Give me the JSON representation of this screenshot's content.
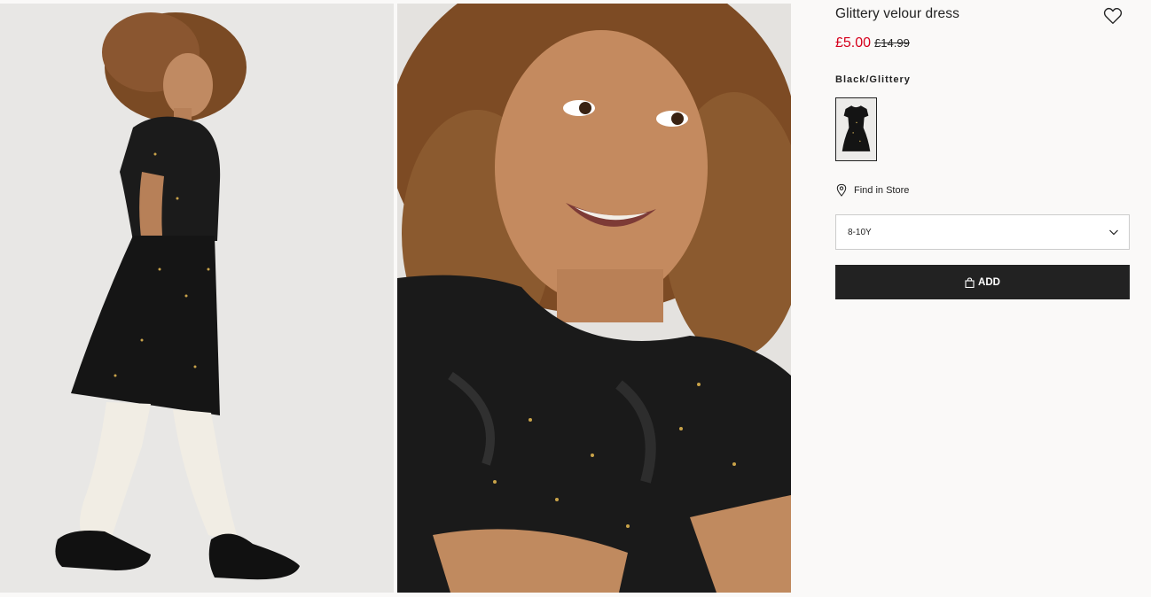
{
  "product": {
    "title": "Glittery velour dress",
    "price_sale": "£5.00",
    "price_original": "£14.99",
    "color_name": "Black/Glittery",
    "find_in_store": "Find in Store",
    "size_selected": "8-10Y",
    "add_label": "ADD"
  },
  "icons": {
    "wishlist": "heart-outline-icon",
    "store": "map-pin-icon",
    "dropdown": "chevron-down-icon",
    "bag": "shopping-bag-icon"
  },
  "colors": {
    "sale_price": "#d6001c",
    "add_button_bg": "#222222",
    "page_bg": "#faf9f8",
    "photo_bg": "#e8e7e5"
  }
}
